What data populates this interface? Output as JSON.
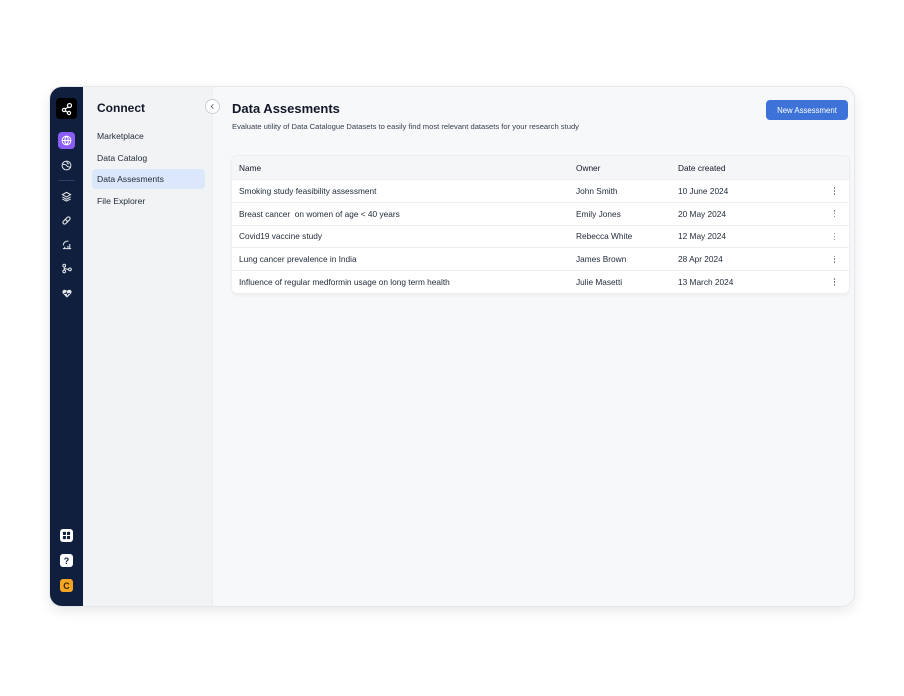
{
  "rail": {
    "icons": [
      {
        "name": "globe-network-icon",
        "active": true
      },
      {
        "name": "globe-icon",
        "active": false
      },
      {
        "name": "layers-icon",
        "active": false
      },
      {
        "name": "pill-icon",
        "active": false
      },
      {
        "name": "analytics-icon",
        "active": false
      },
      {
        "name": "workflow-icon",
        "active": false
      },
      {
        "name": "heart-icon",
        "active": false
      }
    ],
    "bottom": {
      "help_label": "?",
      "avatar_initial": "C"
    },
    "colors": {
      "background": "#0f1f3d",
      "active": "#8b5cf6",
      "avatar": "#f5a524"
    }
  },
  "sidebar": {
    "title": "Connect",
    "items": [
      {
        "label": "Marketplace",
        "active": false
      },
      {
        "label": "Data Catalog",
        "active": false
      },
      {
        "label": "Data Assesments",
        "active": true
      },
      {
        "label": "File Explorer",
        "active": false
      }
    ]
  },
  "main": {
    "title": "Data Assesments",
    "subtitle": "Evaluate utility of Data Catalogue Datasets to easily find most relevant datasets for your research study",
    "new_button_label": "New Assessment",
    "accent": "#3d72d9",
    "table": {
      "columns": [
        "Name",
        "Owner",
        "Date created"
      ],
      "rows": [
        {
          "name": "Smoking study feasibility assessment",
          "owner": "John Smith",
          "date": "10 June 2024"
        },
        {
          "name": "Breast cancer  on women of age < 40 years",
          "owner": "Emily Jones",
          "date": "20 May 2024"
        },
        {
          "name": "Covid19 vaccine study",
          "owner": "Rebecca White",
          "date": "12 May 2024"
        },
        {
          "name": "Lung cancer prevalence in India",
          "owner": "James Brown",
          "date": "28 Apr 2024"
        },
        {
          "name": "Influence of regular medformin usage on long term health",
          "owner": "Julie Masetti",
          "date": "13 March 2024"
        }
      ]
    }
  }
}
